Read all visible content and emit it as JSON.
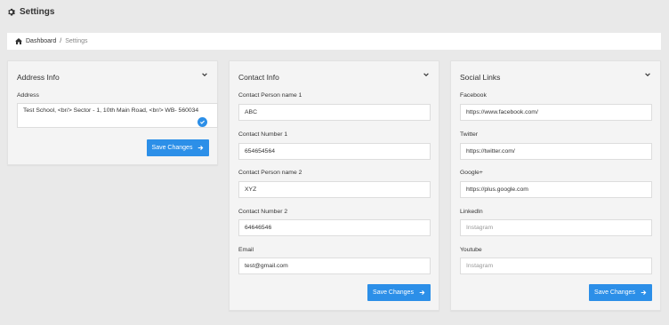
{
  "header": {
    "title": "Settings",
    "icon": "gear-icon"
  },
  "breadcrumb": {
    "home": "Dashboard",
    "separator": "/",
    "current": "Settings"
  },
  "address_card": {
    "title": "Address Info",
    "address_label": "Address",
    "address_value": "Test School, <br/> Sector - 1, 10th Main Road, <br/> WB- 560034",
    "save_label": "Save Changes"
  },
  "contact_card": {
    "title": "Contact Info",
    "person1_label": "Contact Person name 1",
    "person1_value": "ABC",
    "number1_label": "Contact Number 1",
    "number1_value": "654654564",
    "person2_label": "Contact Person name 2",
    "person2_value": "XYZ",
    "number2_label": "Contact Number 2",
    "number2_value": "64646546",
    "email_label": "Email",
    "email_value": "test@gmail.com",
    "save_label": "Save Changes"
  },
  "social_card": {
    "title": "Social Links",
    "facebook_label": "Facebook",
    "facebook_value": "https://www.facebook.com/",
    "twitter_label": "Twitter",
    "twitter_value": "https://twitter.com/",
    "google_label": "Google+",
    "google_value": "https://plus.google.com",
    "linkedin_label": "LinkedIn",
    "linkedin_placeholder": "Instagram",
    "youtube_label": "Youtube",
    "youtube_placeholder": "Instagram",
    "save_label": "Save Changes"
  },
  "colors": {
    "accent": "#2c8fe8",
    "background": "#e9e9e9",
    "card": "#f4f4f4"
  }
}
